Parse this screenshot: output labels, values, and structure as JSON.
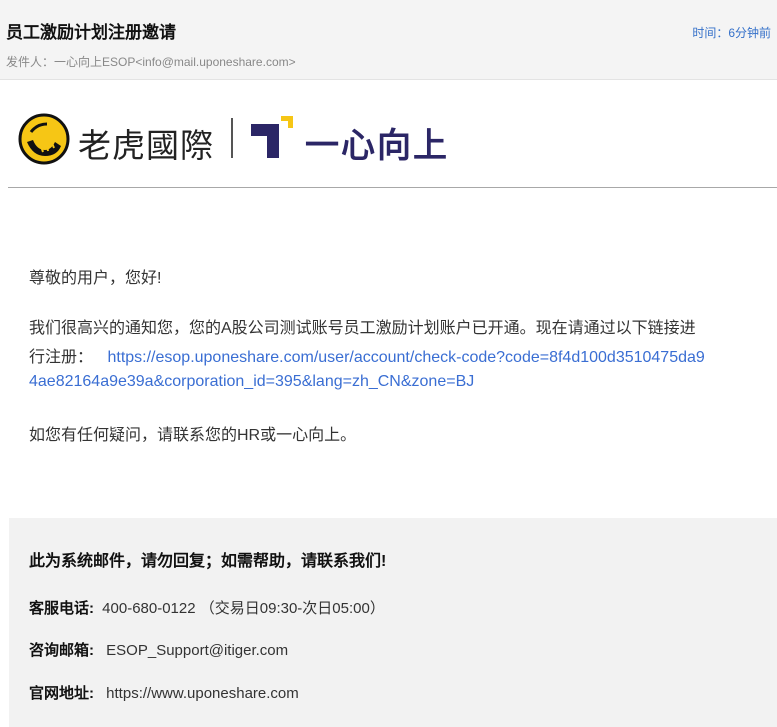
{
  "email": {
    "subject": "员工激励计划注册邀请",
    "time": "时间：6分钟前",
    "sender": "发件人：一心向上ESOP<info@mail.uponeshare.com>"
  },
  "logo": {
    "tiger_text": "老虎國際",
    "brand_text": "一心向上"
  },
  "body": {
    "greeting": "尊敬的用户，您好!",
    "line1": "我们很高兴的通知您，您的A股公司测试账号员工激励计划账户已开通。现在请通过以下链接进",
    "line2_prefix": "行注册：",
    "link_part1": "https://esop.uponeshare.com/user/account/check-code?code=8f4d100d3510475da9",
    "link_part2": "4ae82164a9e39a&corporation_id=395&lang=zh_CN&zone=BJ",
    "closing": "如您有任何疑问，请联系您的HR或一心向上。"
  },
  "footer": {
    "notice": "此为系统邮件，请勿回复；如需帮助，请联系我们!",
    "phone_label": "客服电话:",
    "phone_value": "400-680-0122",
    "phone_hours": "（交易日09:30-次日05:00）",
    "email_label": "咨询邮箱:",
    "email_value": "ESOP_Support@itiger.com",
    "web_label": "官网地址:",
    "web_value": "https://www.uponeshare.com"
  },
  "colors": {
    "link": "#3a6ed3",
    "brand": "#2b2666",
    "tiger_yellow": "#f6c615"
  }
}
